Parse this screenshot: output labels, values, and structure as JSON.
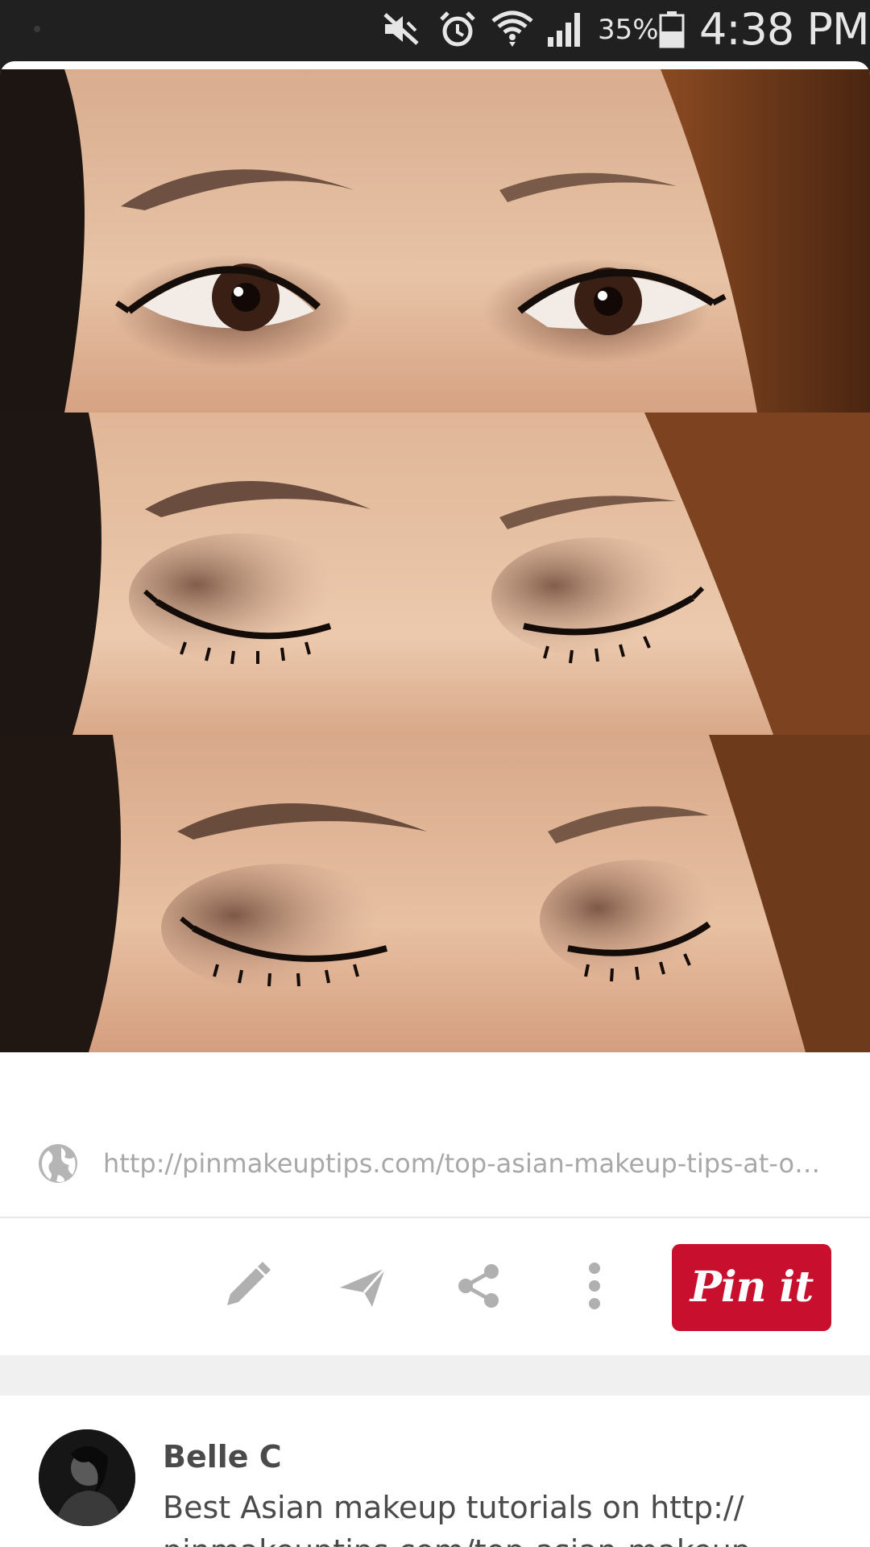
{
  "status_bar": {
    "battery_percent": "35%",
    "time": "4:38 PM",
    "icons": [
      "mute-icon",
      "alarm-icon",
      "wifi-icon",
      "signal-icon",
      "battery-icon"
    ]
  },
  "pin": {
    "image_description": "three-panel eye makeup photo",
    "source_url": "http://pinmakeuptips.com/top-asian-makeup-tips-at-one-place/",
    "actions": [
      "edit-icon",
      "send-icon",
      "share-icon",
      "more-icon"
    ],
    "pin_it_label": "Pin it"
  },
  "pinner": {
    "name": "Belle C",
    "description": "Best Asian makeup tutorials on http:// pinmakeuptips.com/top-asian-makeup-tips-at-one-place/"
  },
  "colors": {
    "pin_button": "#c8102e",
    "status_bar": "#202020"
  }
}
